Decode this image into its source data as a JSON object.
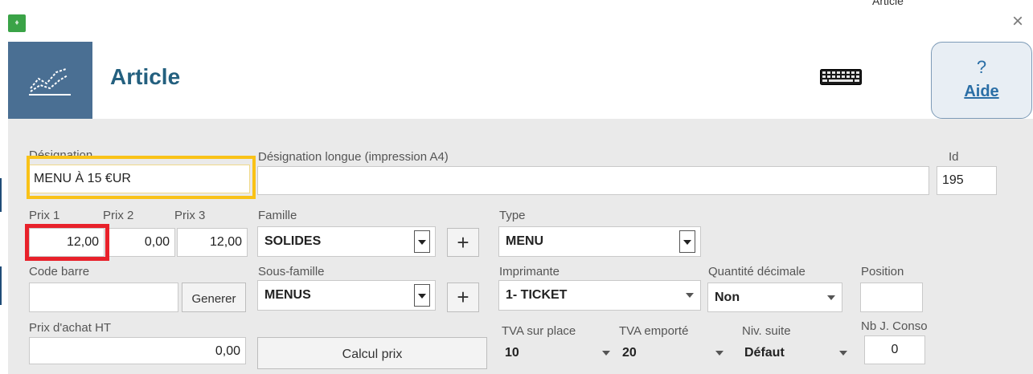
{
  "window": {
    "close_glyph": "×",
    "app_icon": "app-logo-icon",
    "top_cut_text": "Article"
  },
  "header": {
    "title": "Article",
    "logo_icon": "chart-trend-icon",
    "keyboard_icon": "keyboard-icon",
    "help": {
      "glyph": "?",
      "label": "Aide"
    }
  },
  "fields": {
    "designation": {
      "label": "Désignation",
      "value": "MENU À 15 €UR"
    },
    "designation_longue": {
      "label": "Désignation longue (impression A4)",
      "value": ""
    },
    "id": {
      "label": "Id",
      "value": "195"
    },
    "prix1": {
      "label": "Prix 1",
      "value": "12,00"
    },
    "prix2": {
      "label": "Prix 2",
      "value": "0,00"
    },
    "prix3": {
      "label": "Prix 3",
      "value": "12,00"
    },
    "famille": {
      "label": "Famille",
      "value": "SOLIDES"
    },
    "type": {
      "label": "Type",
      "value": "MENU"
    },
    "code_barre": {
      "label": "Code barre",
      "value": "",
      "button": "Generer"
    },
    "sous_famille": {
      "label": "Sous-famille",
      "value": "MENUS"
    },
    "imprimante": {
      "label": "Imprimante",
      "value": "1- TICKET"
    },
    "quantite_decimale": {
      "label": "Quantité décimale",
      "value": "Non"
    },
    "position": {
      "label": "Position",
      "value": ""
    },
    "prix_achat": {
      "label": "Prix d'achat HT",
      "value": "0,00"
    },
    "calcul_prix": {
      "label": "Calcul prix"
    },
    "tva_place": {
      "label": "TVA sur place",
      "value": "10"
    },
    "tva_emporte": {
      "label": "TVA emporté",
      "value": "20"
    },
    "niv_suite": {
      "label": "Niv. suite",
      "value": "Défaut"
    },
    "nb_conso": {
      "label": "Nb J. Conso",
      "value": "0"
    },
    "plus_glyph": "+"
  },
  "colors": {
    "header_accent": "#4a6f93",
    "title": "#24607f",
    "highlight_yellow": "#f9c218",
    "highlight_red": "#e8212a",
    "form_bg": "#eaeaea"
  }
}
